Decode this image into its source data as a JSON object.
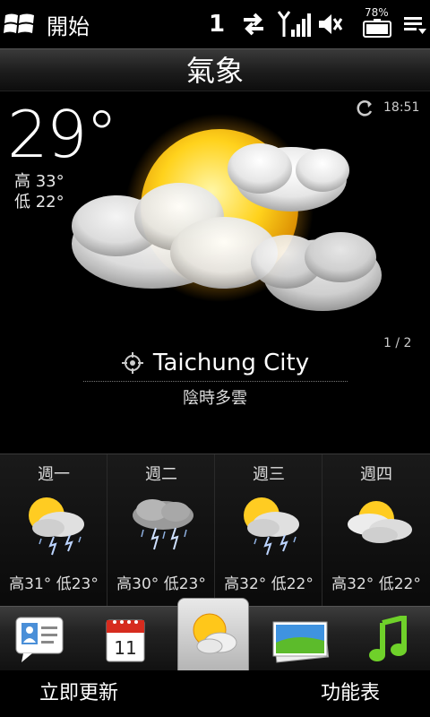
{
  "statusbar": {
    "start_label": "開始",
    "notification_count": "1",
    "battery_percent": "78%"
  },
  "header": {
    "title": "氣象"
  },
  "current": {
    "temperature": "29°",
    "high": "高 33°",
    "low": "低 22°",
    "update_time": "18:51",
    "page_indicator": "1 / 2",
    "city": "Taichung City",
    "condition": "陰時多雲",
    "icon": "partly-cloudy-icon"
  },
  "forecast": [
    {
      "day": "週一",
      "high": "高31°",
      "low": "低23°",
      "icon": "thunderstorm-sun-icon"
    },
    {
      "day": "週二",
      "high": "高30°",
      "low": "低23°",
      "icon": "thunderstorm-icon"
    },
    {
      "day": "週三",
      "high": "高32°",
      "low": "低22°",
      "icon": "thunderstorm-sun-icon"
    },
    {
      "day": "週四",
      "high": "高32°",
      "low": "低22°",
      "icon": "partly-cloudy-icon"
    }
  ],
  "tabs": {
    "people_icon": "people-icon",
    "calendar_day": "11",
    "weather_icon": "weather-icon",
    "photos_icon": "photos-icon",
    "music_icon": "music-icon"
  },
  "softkeys": {
    "left": "立即更新",
    "right": "功能表"
  }
}
